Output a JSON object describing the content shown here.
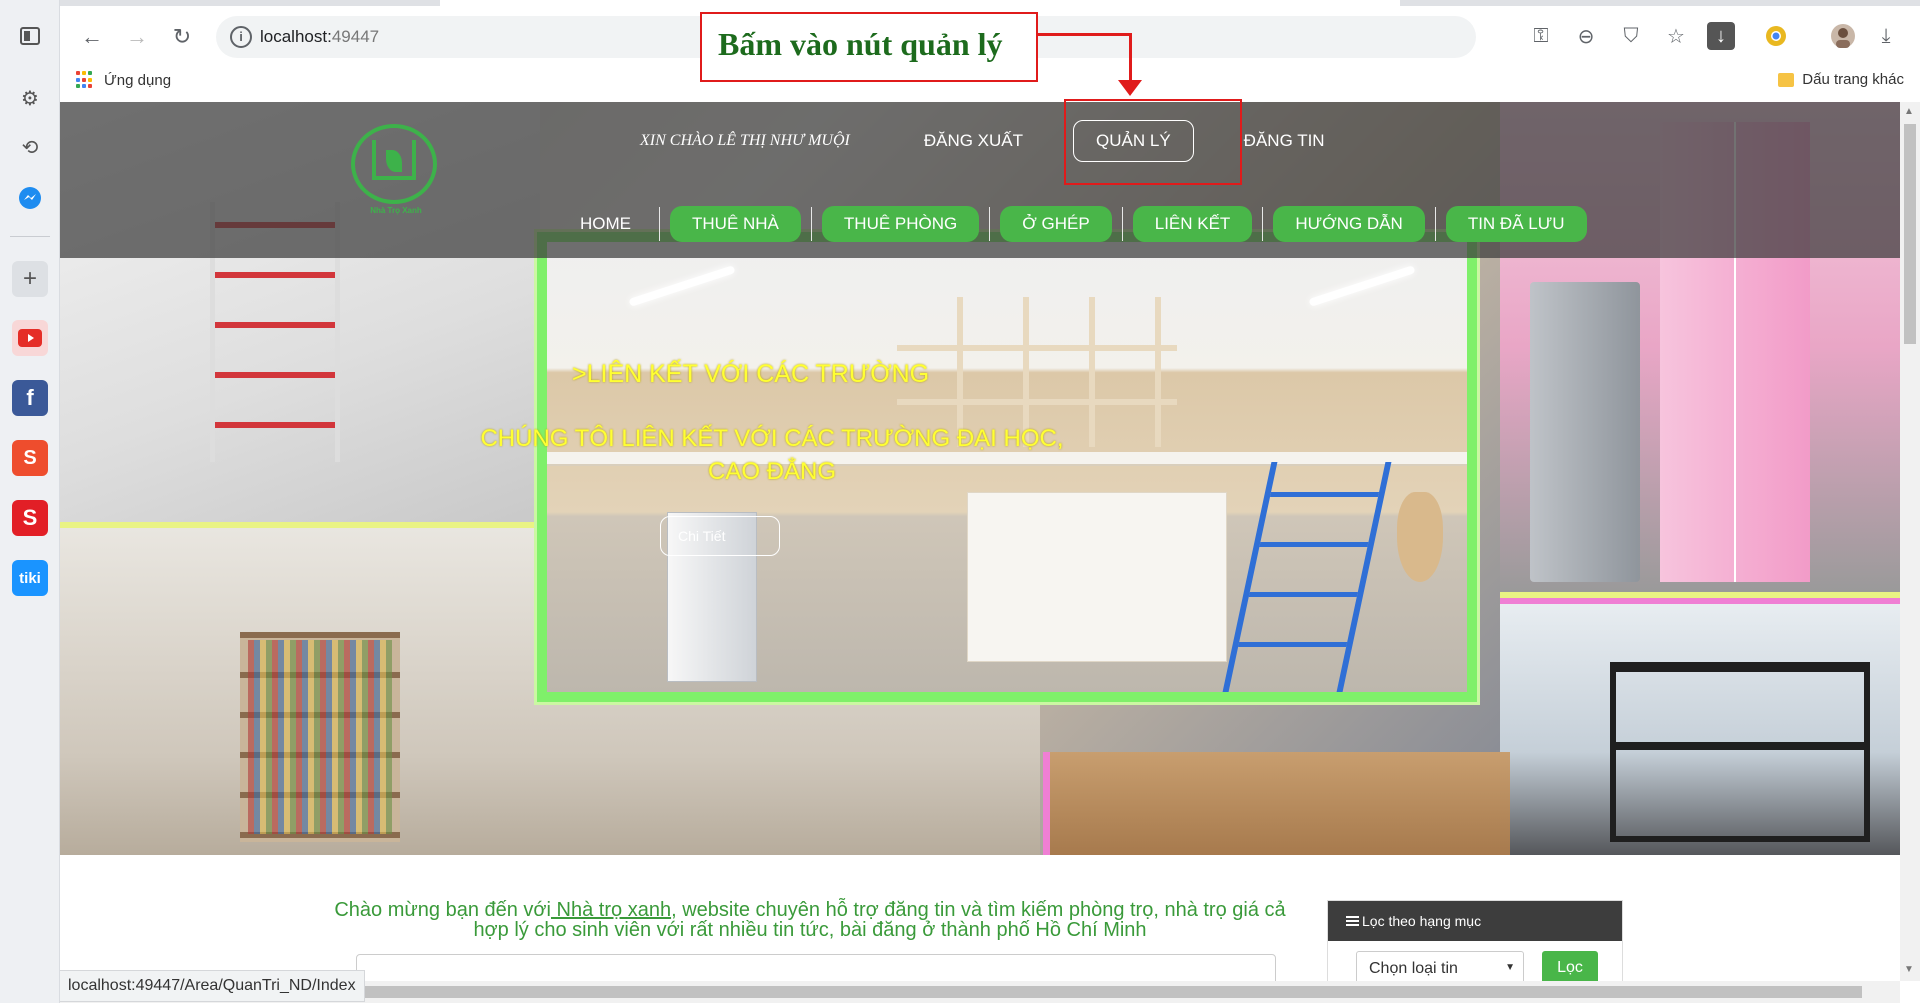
{
  "browser": {
    "url_host": "localhost:",
    "url_port": "49447",
    "bookmarks_apps": "Ứng dụng",
    "bookmarks_other": "Dấu trang khác",
    "status_url": "localhost:49447/Area/QuanTri_ND/Index"
  },
  "dock": {
    "icons": [
      "sidebar-toggle-icon",
      "settings-icon",
      "history-icon",
      "messenger-icon",
      "add-icon",
      "youtube-icon",
      "facebook-icon",
      "shopee-icon",
      "sendo-icon",
      "tiki-icon"
    ],
    "tiki_label": "tiki"
  },
  "header": {
    "greeting": "XIN CHÀO LÊ THỊ NHƯ MUỘI",
    "logout": "ĐĂNG XUẤT",
    "manage": "QUẢN LÝ",
    "post": "ĐĂNG TIN",
    "logo_text": "Nhà Trọ Xanh"
  },
  "nav": {
    "home": "HOME",
    "items": [
      "THUÊ NHÀ",
      "THUÊ PHÒNG",
      "Ở GHÉP",
      "LIÊN KẾT",
      "HƯỚNG DẪN",
      "TIN ĐÃ LƯU"
    ]
  },
  "hero": {
    "title": ">LIÊN KẾT VỚI CÁC TRƯỜNG",
    "subtitle": "CHÚNG TÔI LIÊN KẾT VỚI CÁC TRƯỜNG ĐẠI HỌC, CAO ĐẲNG",
    "button": "Chi Tiết"
  },
  "welcome": {
    "before": "Chào mừng bạn đến với",
    "brand": " Nhà trọ xanh",
    "after": ", website chuyên hỗ trợ đăng tin và tìm kiếm phòng trọ, nhà trọ giá cả hợp lý cho sinh viên với rất nhiều tin tức, bài đăng ở thành phố Hồ Chí Minh"
  },
  "filter": {
    "title": "Lọc theo hạng mục",
    "select_value": "Chọn loại tin",
    "button": "Lọc"
  },
  "annotation": {
    "text": "Bấm vào nút quản lý"
  },
  "colors": {
    "green_accent": "#49b649",
    "annotation_red": "#e01b1b",
    "hero_text_yellow": "#ffff33",
    "feature_border": "#7ff06a"
  }
}
